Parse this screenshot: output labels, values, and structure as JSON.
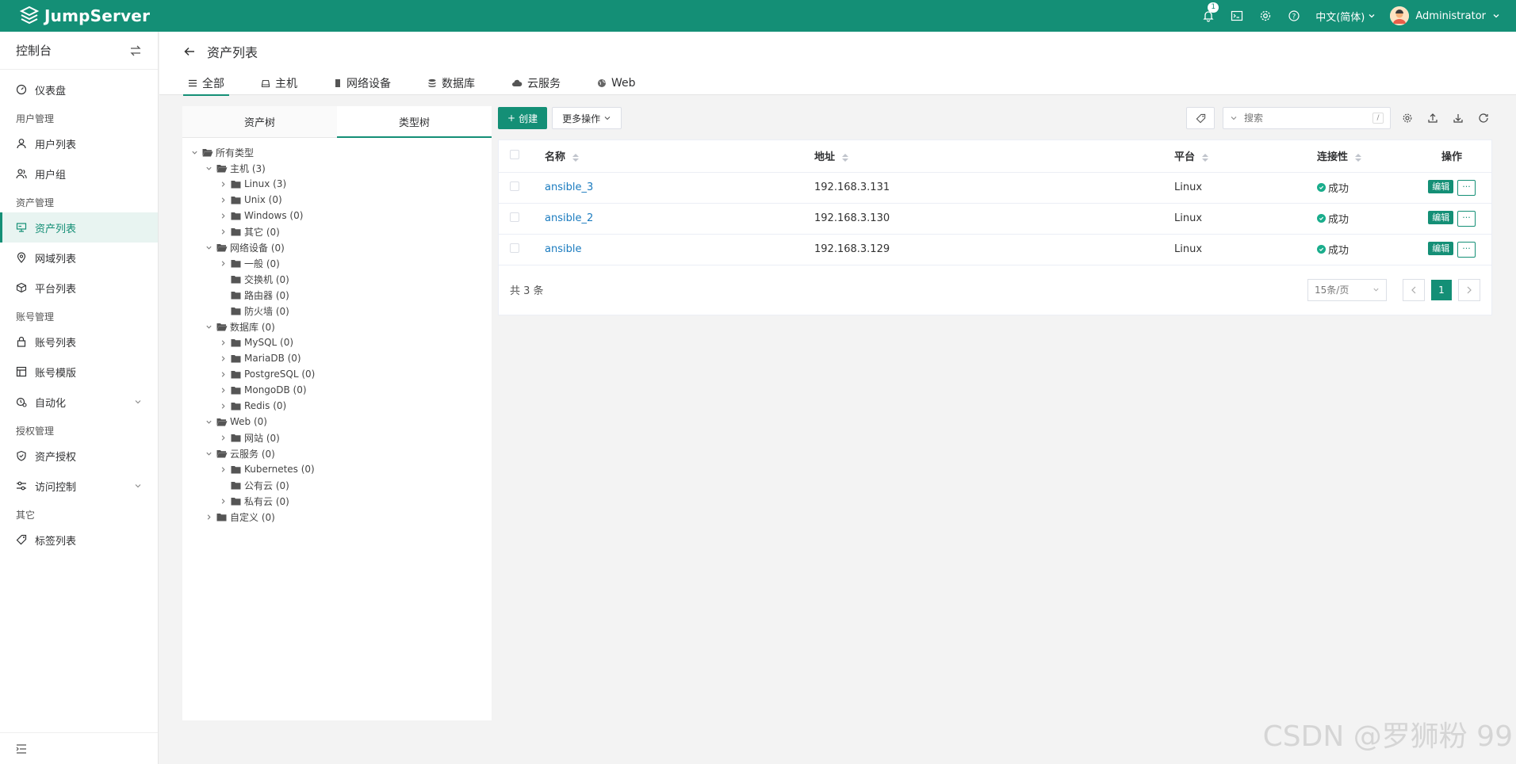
{
  "app": {
    "name": "JumpServer"
  },
  "topbar": {
    "notification_count": "1",
    "language": "中文(简体)",
    "user": "Administrator"
  },
  "sidebar": {
    "title": "控制台",
    "groups": [
      {
        "section": "",
        "items": [
          {
            "label": "仪表盘",
            "icon": "dashboard-icon"
          }
        ]
      },
      {
        "section": "用户管理",
        "items": [
          {
            "label": "用户列表",
            "icon": "user-icon"
          },
          {
            "label": "用户组",
            "icon": "user-group-icon"
          }
        ]
      },
      {
        "section": "资产管理",
        "items": [
          {
            "label": "资产列表",
            "icon": "asset-icon",
            "active": true
          },
          {
            "label": "网域列表",
            "icon": "location-icon"
          },
          {
            "label": "平台列表",
            "icon": "cube-icon"
          }
        ]
      },
      {
        "section": "账号管理",
        "items": [
          {
            "label": "账号列表",
            "icon": "lock-icon"
          },
          {
            "label": "账号模版",
            "icon": "template-icon"
          },
          {
            "label": "自动化",
            "icon": "automation-icon",
            "expandable": true
          }
        ]
      },
      {
        "section": "授权管理",
        "items": [
          {
            "label": "资产授权",
            "icon": "shield-icon"
          },
          {
            "label": "访问控制",
            "icon": "access-icon",
            "expandable": true
          }
        ]
      },
      {
        "section": "其它",
        "items": [
          {
            "label": "标签列表",
            "icon": "tag-icon"
          }
        ]
      }
    ]
  },
  "page": {
    "title": "资产列表",
    "tabs": [
      {
        "label": "全部",
        "active": true
      },
      {
        "label": "主机"
      },
      {
        "label": "网络设备"
      },
      {
        "label": "数据库"
      },
      {
        "label": "云服务"
      },
      {
        "label": "Web"
      }
    ]
  },
  "tree_panel": {
    "tabs": [
      "资产树",
      "类型树"
    ],
    "nodes": [
      {
        "label": "所有类型",
        "level": 0,
        "state": "open"
      },
      {
        "label": "主机 (3)",
        "level": 1,
        "state": "open"
      },
      {
        "label": "Linux (3)",
        "level": 2,
        "state": "closed"
      },
      {
        "label": "Unix (0)",
        "level": 2,
        "state": "closed"
      },
      {
        "label": "Windows (0)",
        "level": 2,
        "state": "closed"
      },
      {
        "label": "其它 (0)",
        "level": 2,
        "state": "closed"
      },
      {
        "label": "网络设备 (0)",
        "level": 1,
        "state": "open"
      },
      {
        "label": "一般 (0)",
        "level": 2,
        "state": "closed"
      },
      {
        "label": "交换机 (0)",
        "level": 2,
        "state": "leaf"
      },
      {
        "label": "路由器 (0)",
        "level": 2,
        "state": "leaf"
      },
      {
        "label": "防火墙 (0)",
        "level": 2,
        "state": "leaf"
      },
      {
        "label": "数据库 (0)",
        "level": 1,
        "state": "open"
      },
      {
        "label": "MySQL (0)",
        "level": 2,
        "state": "closed"
      },
      {
        "label": "MariaDB (0)",
        "level": 2,
        "state": "closed"
      },
      {
        "label": "PostgreSQL (0)",
        "level": 2,
        "state": "closed"
      },
      {
        "label": "MongoDB (0)",
        "level": 2,
        "state": "closed"
      },
      {
        "label": "Redis (0)",
        "level": 2,
        "state": "closed"
      },
      {
        "label": "Web (0)",
        "level": 1,
        "state": "open"
      },
      {
        "label": "网站 (0)",
        "level": 2,
        "state": "closed"
      },
      {
        "label": "云服务 (0)",
        "level": 1,
        "state": "open"
      },
      {
        "label": "Kubernetes (0)",
        "level": 2,
        "state": "closed"
      },
      {
        "label": "公有云 (0)",
        "level": 2,
        "state": "leaf"
      },
      {
        "label": "私有云 (0)",
        "level": 2,
        "state": "closed"
      },
      {
        "label": "自定义 (0)",
        "level": 1,
        "state": "closed"
      }
    ]
  },
  "toolbar": {
    "create_label": "创建",
    "more_label": "更多操作",
    "search_placeholder": "搜索",
    "search_shortcut": "/"
  },
  "table": {
    "columns": [
      "名称",
      "地址",
      "平台",
      "连接性",
      "操作"
    ],
    "rows": [
      {
        "name": "ansible_3",
        "address": "192.168.3.131",
        "platform": "Linux",
        "connectivity": "成功"
      },
      {
        "name": "ansible_2",
        "address": "192.168.3.130",
        "platform": "Linux",
        "connectivity": "成功"
      },
      {
        "name": "ansible",
        "address": "192.168.3.129",
        "platform": "Linux",
        "connectivity": "成功"
      }
    ],
    "edit_label": "编辑",
    "more_label": "···"
  },
  "pagination": {
    "total": "共 3 条",
    "page_size": "15条/页",
    "current_page": "1"
  },
  "watermark": "CSDN @罗狮粉 99",
  "colors": {
    "brand": "#148f76",
    "link": "#1a7bbf",
    "success": "#1aad8c"
  }
}
